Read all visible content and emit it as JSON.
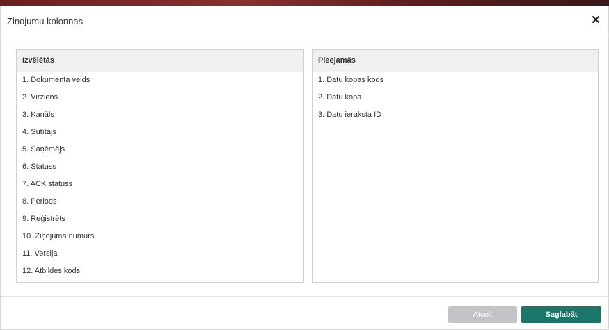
{
  "dialog": {
    "title": "Ziņojumu kolonnas",
    "close_glyph": "✕"
  },
  "selected_panel": {
    "header": "Izvēlētās",
    "items": [
      "1. Dokumenta veids",
      "2. Virziens",
      "3. Kanāls",
      "4. Sūtītājs",
      "5. Saņēmējs",
      "6. Statuss",
      "7. ACK statuss",
      "8. Periods",
      "9. Reģistrēts",
      "10. Ziņojuma numurs",
      "11. Versija",
      "12. Atbildes kods"
    ]
  },
  "available_panel": {
    "header": "Pieejamās",
    "items": [
      "1. Datu kopas kods",
      "2. Datu kopa",
      "3. Datu ieraksta ID"
    ]
  },
  "footer": {
    "cancel_label": "Atcelt",
    "save_label": "Saglabāt"
  },
  "colors": {
    "save_button": "#1a7668",
    "cancel_button": "#c2c4c7",
    "panel_header_bg": "#f0f0f0"
  }
}
